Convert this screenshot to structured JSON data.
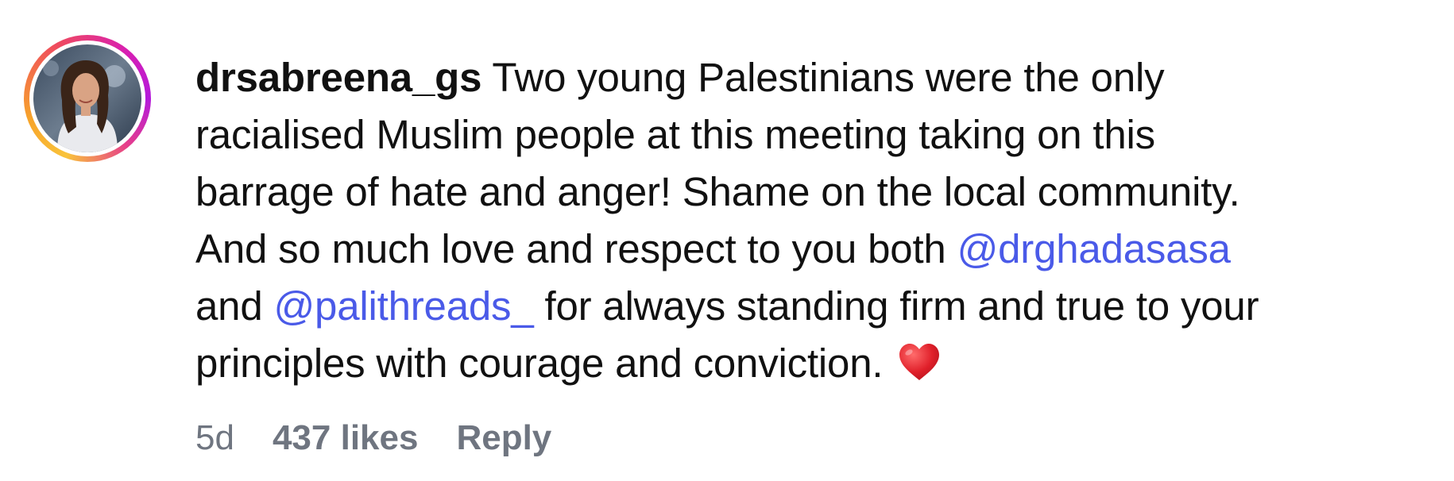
{
  "comment": {
    "username": "drsabreena_gs",
    "line1_rest": " Two young Palestinians were the only",
    "line2": "racialised Muslim people at this meeting taking on this",
    "line3": "barrage of hate and anger! Shame on the local community.",
    "line4_text": "And so much love and respect to you both ",
    "mention1": "@drghadasasa",
    "line5_start": "and ",
    "mention2": "@palithreads_",
    "line5_rest": " for always standing firm and true to your",
    "line6": "principles with courage and conviction. "
  },
  "meta": {
    "time": "5d",
    "likes": "437 likes",
    "reply": "Reply"
  },
  "icons": {
    "heart": "red-heart-emoji",
    "avatar": "profile-photo"
  },
  "colors": {
    "mention": "#4a5ae8",
    "meta": "#6f7580",
    "heart": "#e0202a"
  }
}
